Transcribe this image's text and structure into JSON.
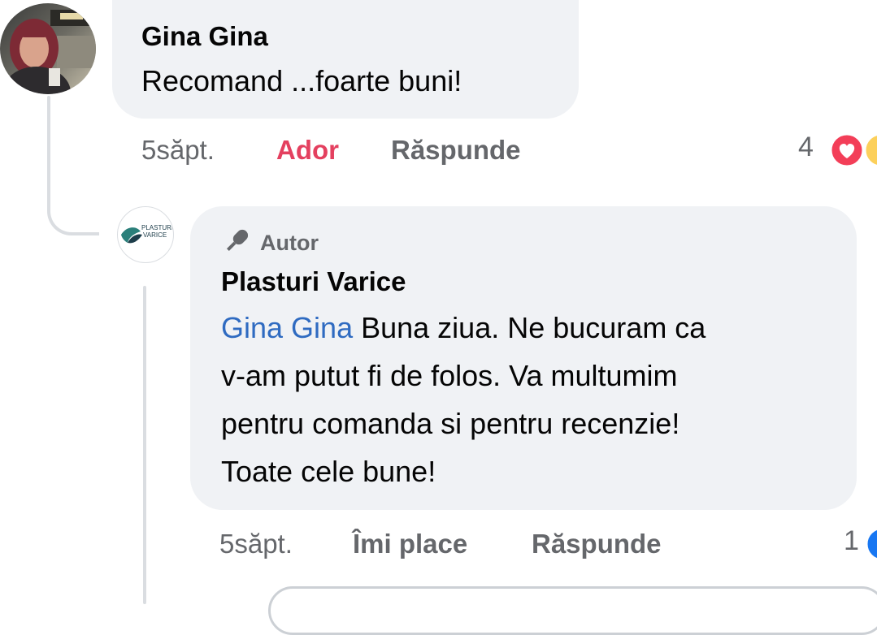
{
  "comment": {
    "author": "Gina Gina",
    "text": "Recomand ...foarte buni!",
    "time": "5săpt.",
    "reaction_label": "Ador",
    "reply_label": "Răspunde",
    "reaction_count": "4"
  },
  "reply": {
    "badge": "Autor",
    "author": "Plasturi Varice",
    "mention": "Gina Gina",
    "text_line1": " Buna ziua. Ne bucuram ca",
    "text_line2": "v-am putut fi de folos. Va multumim",
    "text_line3": "pentru comanda si pentru recenzie!",
    "text_line4": "Toate cele bune!",
    "time": "5săpt.",
    "like_label": "Îmi place",
    "reply_label": "Răspunde",
    "reaction_count": "1",
    "logo_text_line1": "PLASTURI",
    "logo_text_line2": "VARICE"
  },
  "colors": {
    "bubble": "#f0f2f5",
    "secondary_text": "#65676b",
    "mention": "#2f6bc1",
    "love": "#e4405f",
    "like": "#1877f2"
  },
  "icons": [
    "microphone-icon",
    "love-reaction-icon",
    "haha-reaction-icon",
    "like-reaction-icon"
  ]
}
